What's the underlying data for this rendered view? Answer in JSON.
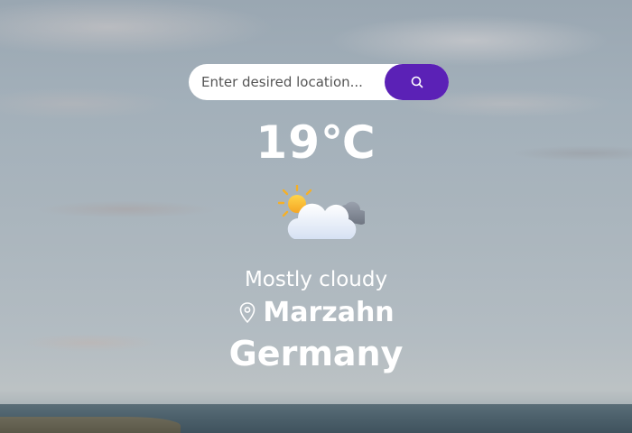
{
  "search": {
    "placeholder": "Enter desired location...",
    "button_icon": "search-icon"
  },
  "weather": {
    "temperature": "19℃",
    "icon": "partly-cloudy-icon",
    "condition": "Mostly cloudy"
  },
  "location": {
    "pin_icon": "location-pin-icon",
    "city": "Marzahn",
    "country": "Germany"
  },
  "colors": {
    "accent": "#5b21b6",
    "text": "#ffffff",
    "search_background": "#ffffff"
  }
}
